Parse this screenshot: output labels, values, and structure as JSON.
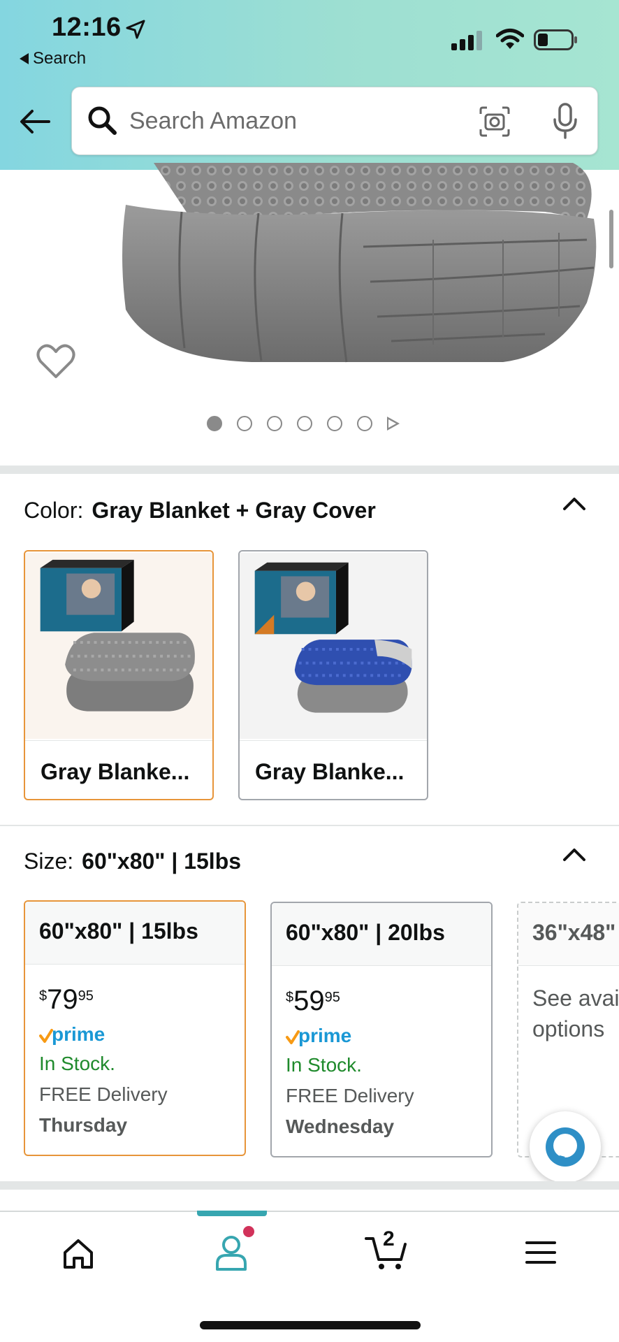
{
  "status_bar": {
    "time": "12:16",
    "back_label": "Search"
  },
  "search": {
    "placeholder": "Search Amazon"
  },
  "gallery": {
    "dot_count": 6,
    "active_index": 0
  },
  "color_section": {
    "label": "Color:",
    "value": "Gray Blanket + Gray Cover",
    "options": [
      {
        "label": "Gray Blanke...",
        "selected": true,
        "cover_color": "#6f6f6f"
      },
      {
        "label": "Gray Blanke...",
        "selected": false,
        "cover_color": "#2f4fb0"
      }
    ]
  },
  "size_section": {
    "label": "Size:",
    "value": "60\"x80\" | 15lbs",
    "options": [
      {
        "size": "60\"x80\" | 15lbs",
        "price_whole": "79",
        "price_fraction": "95",
        "currency": "$",
        "prime": "prime",
        "stock": "In Stock.",
        "delivery": "FREE Delivery",
        "day": "Thursday",
        "selected": true
      },
      {
        "size": "60\"x80\" | 20lbs",
        "price_whole": "59",
        "price_fraction": "95",
        "currency": "$",
        "prime": "prime",
        "stock": "In Stock.",
        "delivery": "FREE Delivery",
        "day": "Wednesday",
        "selected": false
      },
      {
        "size": "36\"x48\"",
        "see_options": "See available options",
        "selected": false
      }
    ]
  },
  "bottom_nav": {
    "items": [
      "home-icon",
      "account-icon",
      "cart-icon",
      "menu-icon"
    ],
    "cart_count": "2",
    "active": "account-icon"
  },
  "colors": {
    "selected_border": "#e7953a",
    "in_stock": "#1f8a2c",
    "prime_blue": "#1a98d5",
    "accent_teal": "#37a6b0"
  }
}
